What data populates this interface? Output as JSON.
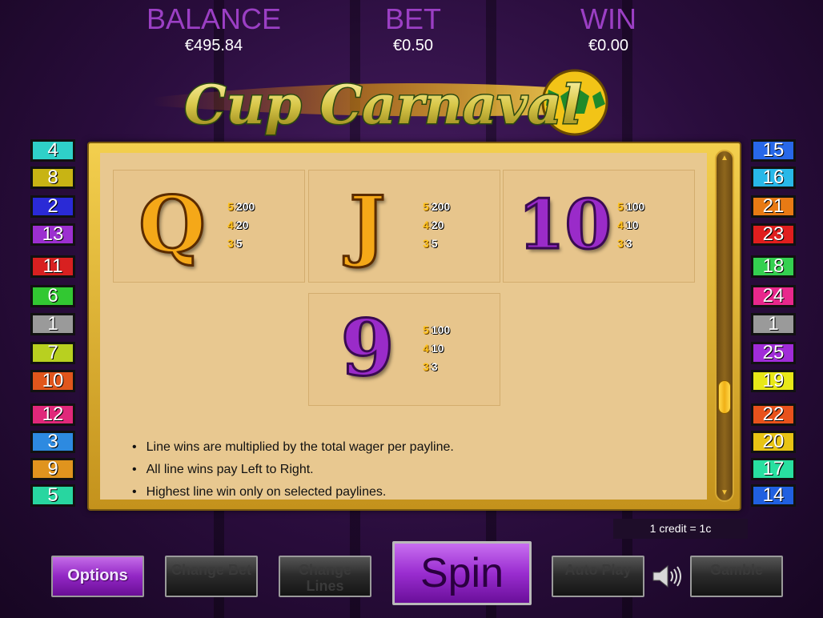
{
  "header": {
    "balance": {
      "label": "BALANCE",
      "value": "€495.84"
    },
    "bet": {
      "label": "BET",
      "value": "€0.50"
    },
    "win": {
      "label": "WIN",
      "value": "€0.00"
    },
    "logo_text": "Cup Carnaval"
  },
  "paylines": {
    "left": [
      {
        "num": "4",
        "color": "#2fd0c8"
      },
      {
        "num": "8",
        "color": "#c8b414"
      },
      {
        "num": "2",
        "color": "#2a2ad6"
      },
      {
        "num": "13",
        "color": "#9c2fd0"
      },
      {
        "num": "11",
        "color": "#d82020"
      },
      {
        "num": "6",
        "color": "#32c832"
      },
      {
        "num": "1",
        "color": "#9a9a9a"
      },
      {
        "num": "7",
        "color": "#b8d020"
      },
      {
        "num": "10",
        "color": "#e0561c"
      },
      {
        "num": "12",
        "color": "#e0287a"
      },
      {
        "num": "3",
        "color": "#2d8ae0"
      },
      {
        "num": "9",
        "color": "#e0941e"
      },
      {
        "num": "5",
        "color": "#28d6a0"
      }
    ],
    "right": [
      {
        "num": "15",
        "color": "#2868e8"
      },
      {
        "num": "16",
        "color": "#28b8e8"
      },
      {
        "num": "21",
        "color": "#e87a14"
      },
      {
        "num": "23",
        "color": "#e01e1e"
      },
      {
        "num": "18",
        "color": "#34d050"
      },
      {
        "num": "24",
        "color": "#e8288c"
      },
      {
        "num": "1",
        "color": "#9a9a9a"
      },
      {
        "num": "25",
        "color": "#a02cd8"
      },
      {
        "num": "19",
        "color": "#e8e818"
      },
      {
        "num": "22",
        "color": "#e8521c"
      },
      {
        "num": "20",
        "color": "#e8c414"
      },
      {
        "num": "17",
        "color": "#28e0a0"
      },
      {
        "num": "14",
        "color": "#2060e0"
      }
    ]
  },
  "paytable": {
    "symbols": [
      {
        "glyph": "Q",
        "style": "gold",
        "pays": [
          {
            "count": "5",
            "amount": "200"
          },
          {
            "count": "4",
            "amount": "20"
          },
          {
            "count": "3",
            "amount": "5"
          }
        ]
      },
      {
        "glyph": "J",
        "style": "gold",
        "pays": [
          {
            "count": "5",
            "amount": "200"
          },
          {
            "count": "4",
            "amount": "20"
          },
          {
            "count": "3",
            "amount": "5"
          }
        ]
      },
      {
        "glyph": "10",
        "style": "purple",
        "pays": [
          {
            "count": "5",
            "amount": "100"
          },
          {
            "count": "4",
            "amount": "10"
          },
          {
            "count": "3",
            "amount": "3"
          }
        ]
      },
      {
        "glyph": "9",
        "style": "purple",
        "pays": [
          {
            "count": "5",
            "amount": "100"
          },
          {
            "count": "4",
            "amount": "10"
          },
          {
            "count": "3",
            "amount": "3"
          }
        ]
      }
    ],
    "rules": [
      "Line wins are multiplied by the total wager per payline.",
      "All line wins pay Left to Right.",
      "Highest line win only on selected paylines."
    ]
  },
  "credit_info": "1 credit = 1c",
  "buttons": {
    "options": "Options",
    "change_bet": "Change Bet",
    "change_lines": "Change Lines",
    "spin": "Spin",
    "auto_play": "Auto Play",
    "gamble": "Gamble"
  },
  "icons": {
    "sound": "speaker-icon",
    "scroll_up": "arrow-up-icon",
    "scroll_down": "arrow-down-icon"
  }
}
